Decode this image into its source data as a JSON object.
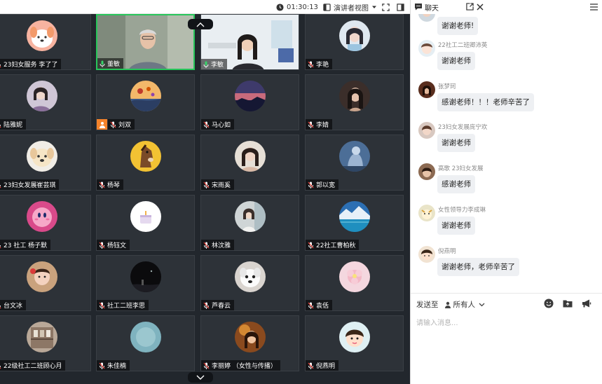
{
  "toolbar": {
    "timer": "01:30:13",
    "view_mode": "演讲者视图"
  },
  "chat": {
    "tab_title": "聊天",
    "messages": [
      {
        "name": "",
        "text": "谢谢老师!"
      },
      {
        "name": "22社工二班卿沛英",
        "text": "谢谢老师"
      },
      {
        "name": "张梦珂",
        "text": "感谢老师！！！老师辛苦了"
      },
      {
        "name": "23妇女发展庞宁欢",
        "text": "谢谢老师"
      },
      {
        "name": "高歌 23妇女发展",
        "text": "感谢老师"
      },
      {
        "name": "女性领导力李成琳",
        "text": "谢谢老师"
      },
      {
        "name": "倪燕明",
        "text": "谢谢老师，老师辛苦了"
      }
    ],
    "send_to_label": "发送至",
    "recipient": "所有人",
    "input_placeholder": "请输入消息..."
  },
  "participants": [
    {
      "name": "23妇女服务 李了了",
      "avatar": "dog-cartoon"
    },
    {
      "name": "董敏",
      "avatar": "video-man"
    },
    {
      "name": "李敏",
      "avatar": "video-woman"
    },
    {
      "name": "李艳",
      "avatar": "girl-photo"
    },
    {
      "name": "陆雅妮",
      "avatar": "woman-photo"
    },
    {
      "name": "刘双",
      "avatar": "balloon-sky"
    },
    {
      "name": "马心如",
      "avatar": "sunset"
    },
    {
      "name": "李婧",
      "avatar": "girl-dark"
    },
    {
      "name": "23妇女发展崔芸琪",
      "avatar": "puppy"
    },
    {
      "name": "杨琴",
      "avatar": "horse-cartoon"
    },
    {
      "name": "宋雨奚",
      "avatar": "woman-portrait"
    },
    {
      "name": "郭以宽",
      "avatar": "blue-art"
    },
    {
      "name": "23 社工 杨子默",
      "avatar": "kirby"
    },
    {
      "name": "杨钰文",
      "avatar": "cake"
    },
    {
      "name": "林汶雅",
      "avatar": "girl-window"
    },
    {
      "name": "22社工曹柏秋",
      "avatar": "lake"
    },
    {
      "name": "台文冰",
      "avatar": "child"
    },
    {
      "name": "社工二班李思",
      "avatar": "night"
    },
    {
      "name": "芦春云",
      "avatar": "white-dog"
    },
    {
      "name": "袁佸",
      "avatar": "pink-flower"
    },
    {
      "name": "22级社工二班顾心月",
      "avatar": "shelf"
    },
    {
      "name": "朱佳楠",
      "avatar": "teal"
    },
    {
      "name": "李丽婷 （女性与传播）",
      "avatar": "warm-girl"
    },
    {
      "name": "倪燕明",
      "avatar": "cartoon-girl"
    }
  ]
}
